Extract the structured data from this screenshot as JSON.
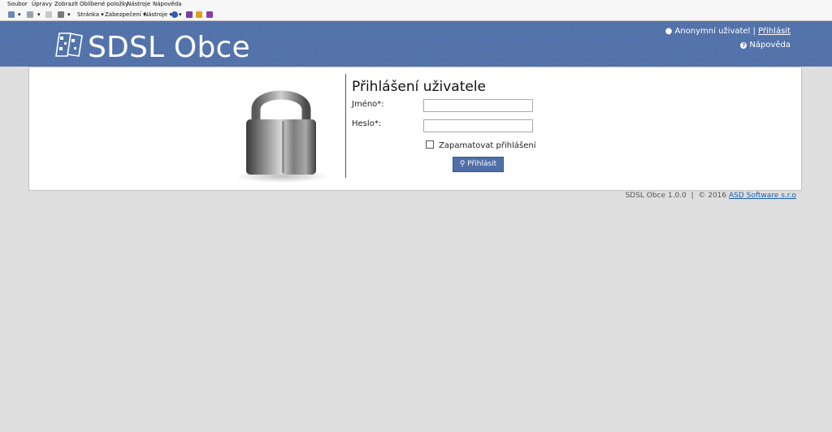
{
  "browser": {
    "menu": [
      "Soubor",
      "Úpravy",
      "Zobrazit",
      "Oblíbené položky",
      "Nástroje",
      "Nápověda"
    ],
    "commands": {
      "page": "Stránka",
      "security": "Zabezpečení",
      "tools": "Nástroje"
    }
  },
  "header": {
    "title": "SDSL Obce",
    "user": "Anonymní uživatel",
    "separator": "|",
    "login_link": "Přihlásit",
    "help": "Nápověda"
  },
  "login": {
    "title": "Přihlášení uživatele",
    "username_label": "Jméno*:",
    "username_value": "",
    "password_label": "Heslo*:",
    "password_value": "",
    "remember_label": "Zapamatovat přihlášení",
    "remember_checked": false,
    "submit_label": "Přihlásit"
  },
  "footer": {
    "version": "SDSL Obce 1.0.0",
    "separator": "|",
    "copyright": "© 2016",
    "company": "ASD Software s.r.o"
  },
  "colors": {
    "header_bg": "#4f6fa8",
    "page_bg": "#dedede",
    "link": "#1a5fb4"
  }
}
